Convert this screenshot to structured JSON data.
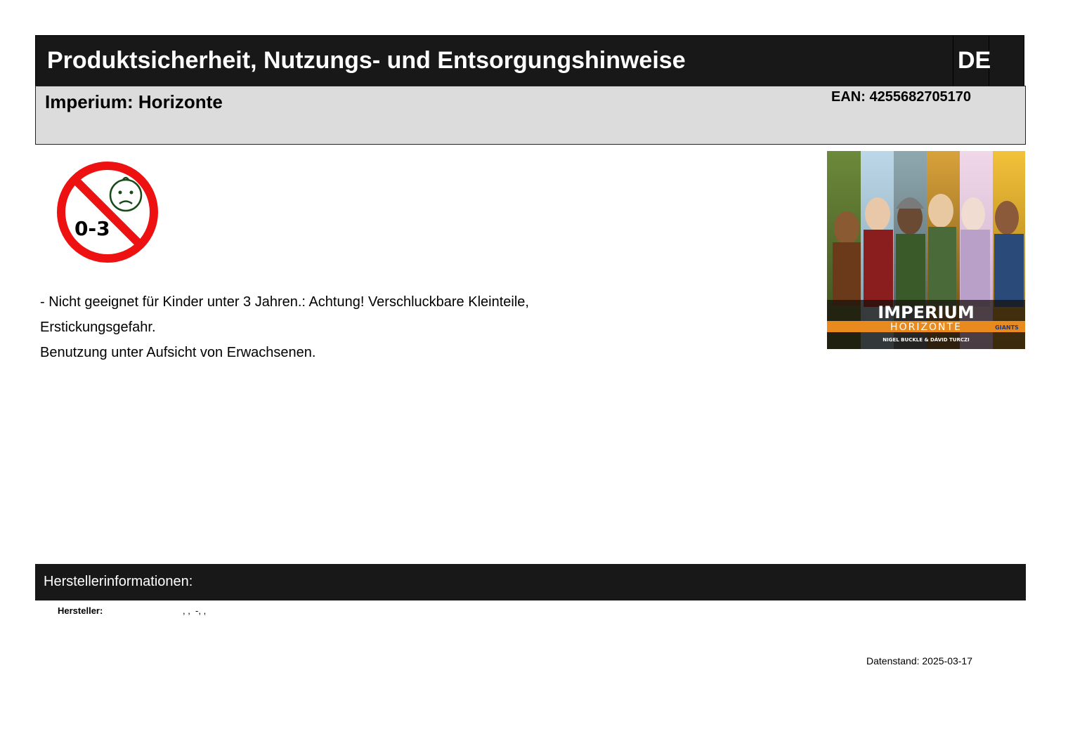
{
  "header": {
    "title": "Produktsicherheit, Nutzungs- und Entsorgungshinweise",
    "language": "DE"
  },
  "product": {
    "name": "Imperium: Horizonte",
    "ean_label": "EAN:",
    "ean_value": "4255682705170"
  },
  "warning_icon": {
    "name": "age-0-3-prohibited-icon",
    "age_label": "0-3",
    "ring_color": "#ee1111",
    "face_color": "#1a4a1a"
  },
  "box_art": {
    "name": "imperium-horizonte-box-art",
    "title": "IMPERIUM",
    "subtitle": "HORIZONTE",
    "authors": "NIGEL BUCKLE & DÁVID TURCZI",
    "publisher_logo": "GIANTS",
    "accent_color": "#e88a1e"
  },
  "notice": {
    "lines": [
      "- Nicht geeignet für Kinder unter 3 Jahren.: Achtung! Verschluckbare Kleinteile,",
      "Erstickungsgefahr.",
      "Benutzung unter Aufsicht von Erwachsenen."
    ]
  },
  "manufacturer": {
    "section_title": "Herstellerinformationen:",
    "label": "Hersteller:",
    "value": ", ,  -, ,"
  },
  "footer": {
    "data_date": "Datenstand: 2025-03-17"
  }
}
